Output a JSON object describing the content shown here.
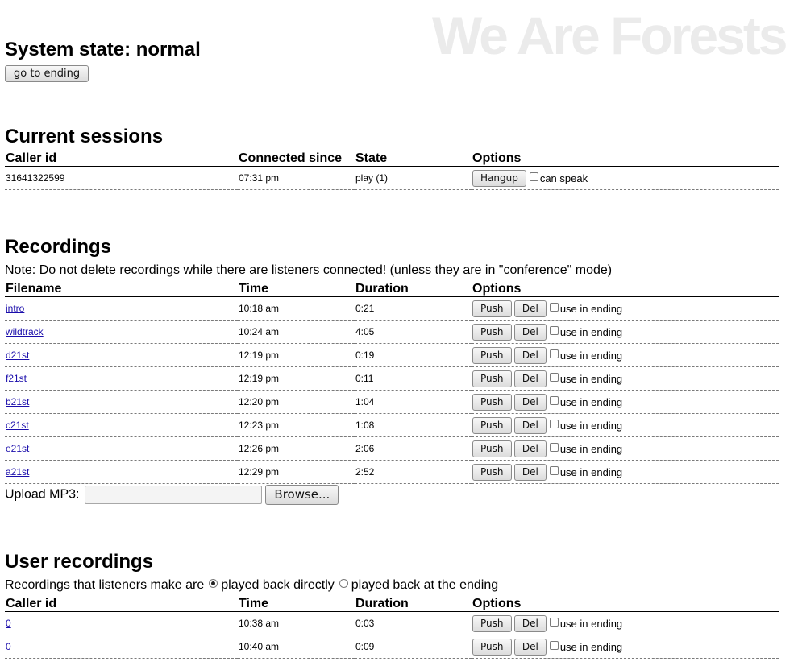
{
  "brand": "We Are Forests",
  "system": {
    "title": "System state: normal",
    "go_to_ending_label": "go to ending"
  },
  "sessions": {
    "heading": "Current sessions",
    "columns": [
      "Caller id",
      "Connected since",
      "State",
      "Options"
    ],
    "rows": [
      {
        "caller_id": "31641322599",
        "since": "07:31 pm",
        "state": "play (1)",
        "hangup_label": "Hangup",
        "option_label": "can speak"
      }
    ]
  },
  "recordings": {
    "heading": "Recordings",
    "note": "Note: Do not delete recordings while there are listeners connected! (unless they are in \"conference\" mode)",
    "columns": [
      "Filename",
      "Time",
      "Duration",
      "Options"
    ],
    "push_label": "Push",
    "del_label": "Del",
    "option_label": "use in ending",
    "rows": [
      {
        "name": "intro",
        "time": "10:18 am",
        "duration": "0:21"
      },
      {
        "name": "wildtrack",
        "time": "10:24 am",
        "duration": "4:05"
      },
      {
        "name": "d21st",
        "time": "12:19 pm",
        "duration": "0:19"
      },
      {
        "name": "f21st",
        "time": "12:19 pm",
        "duration": "0:11"
      },
      {
        "name": "b21st",
        "time": "12:20 pm",
        "duration": "1:04"
      },
      {
        "name": "c21st",
        "time": "12:23 pm",
        "duration": "1:08"
      },
      {
        "name": "e21st",
        "time": "12:26 pm",
        "duration": "2:06"
      },
      {
        "name": "a21st",
        "time": "12:29 pm",
        "duration": "2:52"
      }
    ],
    "upload_label": "Upload MP3:",
    "browse_label": "Browse..."
  },
  "user_recordings": {
    "heading": "User recordings",
    "intro": "Recordings that listeners make are",
    "radio_options": [
      {
        "label": "played back directly",
        "selected": true
      },
      {
        "label": "played back at the ending",
        "selected": false
      }
    ],
    "columns": [
      "Caller id",
      "Time",
      "Duration",
      "Options"
    ],
    "push_label": "Push",
    "del_label": "Del",
    "option_label": "use in ending",
    "rows": [
      {
        "caller_id": "0",
        "time": "10:38 am",
        "duration": "0:03"
      },
      {
        "caller_id": "0",
        "time": "10:40 am",
        "duration": "0:09"
      }
    ]
  }
}
